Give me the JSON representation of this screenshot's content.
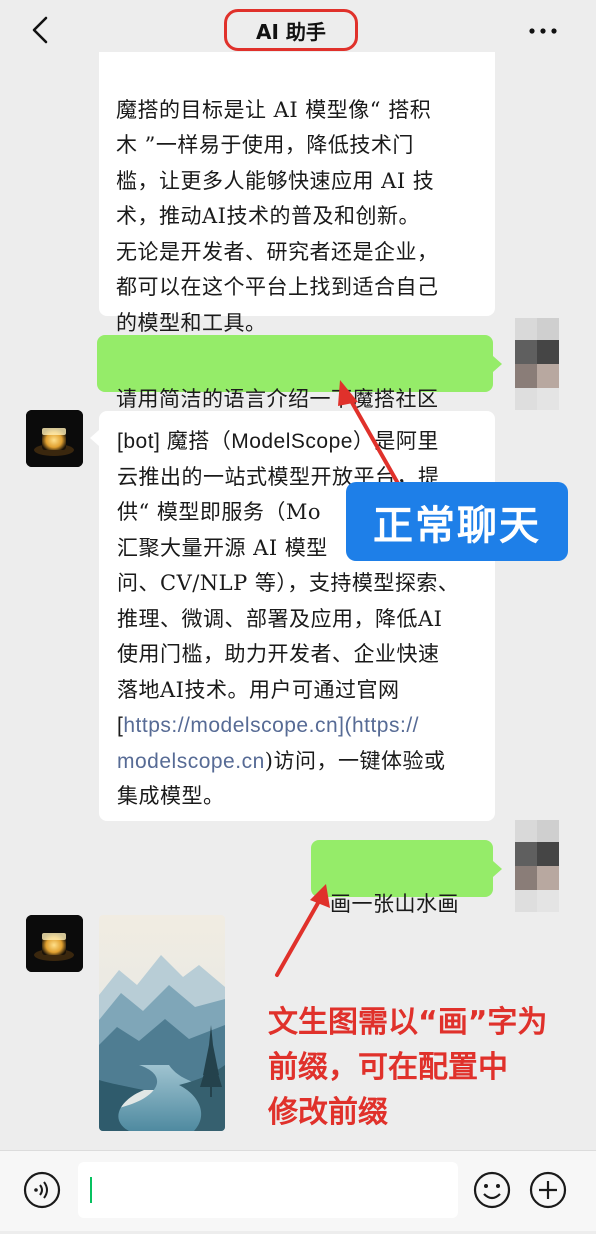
{
  "header": {
    "title": "AI 助手",
    "back_icon": "chevron-left-icon",
    "more_icon": "more-dots-icon"
  },
  "messages": {
    "m1": {
      "sender": "bot",
      "text": "魔搭的目标是让 AI 模型像“ 搭积\n木 ”一样易于使用，降低技术门\n槛，让更多人能够快速应用 AI 技\n术，推动AI技术的普及和创新。\n无论是开发者、研究者还是企业，\n都可以在这个平台上找到适合自己\n的模型和工具。"
    },
    "m2": {
      "sender": "user",
      "text": "请用简洁的语言介绍一下魔搭社区"
    },
    "m3": {
      "sender": "bot",
      "l1": "[bot] 魔搭（ModelScope）是阿里",
      "l2": "云推出的一站式模型开放平台，提",
      "l3": "供“ 模型即服务（Mo",
      "l4": "汇聚大量开源 AI 模型",
      "l5": "问、CV/NLP 等），支持模型探索、",
      "l6": "推理、微调、部署及应用，降低AI",
      "l7": "使用门槛，助力开发者、企业快速",
      "l8": "落地AI技术。用户可通过官网",
      "l9_pre": "[",
      "l9_link": "https://modelscope.cn",
      "l9_post": "](https://",
      "l10_link": "modelscope.cn",
      "l10_post": ")访问，一键体验或",
      "l11": "集成模型。"
    },
    "m4": {
      "sender": "user",
      "text": "画一张山水画"
    },
    "m5": {
      "sender": "bot",
      "image": "mountain-landscape-painting"
    }
  },
  "annotations": {
    "callout": "正常聊天",
    "note": "文生图需以“画”字为\n前缀，可在配置中\n修改前缀",
    "color_red": "#e0312b",
    "color_blue": "#1e7fe8"
  },
  "input_bar": {
    "voice_icon": "voice-icon",
    "emoji_icon": "emoji-icon",
    "plus_icon": "plus-circle-icon",
    "value": ""
  }
}
